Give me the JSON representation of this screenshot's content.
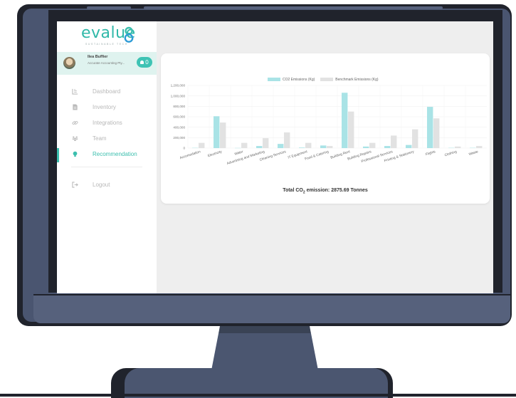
{
  "brand": {
    "logo_text": "evalue",
    "logo_tagline": "SUSTAINABLE TECH",
    "accent_color": "#3cbfae"
  },
  "user": {
    "name": "Ilea Buffier",
    "org": "Accurate Accounting Pty...",
    "notifications": "0"
  },
  "nav": {
    "items": [
      {
        "label": "Dashboard",
        "icon": "dashboard-icon"
      },
      {
        "label": "Inventory",
        "icon": "inventory-icon"
      },
      {
        "label": "Integrations",
        "icon": "link-icon"
      },
      {
        "label": "Team",
        "icon": "team-icon"
      },
      {
        "label": "Recommendation",
        "icon": "lightbulb-icon",
        "active": true
      }
    ],
    "logout_label": "Logout"
  },
  "chart_data": {
    "type": "bar",
    "categories": [
      "Accomodation",
      "Electricity",
      "Water",
      "Advertising and Marketing",
      "Cleaning Services",
      "IT Equipment",
      "Food & Catering",
      "Building Rent",
      "Building Repairs",
      "Professional Services",
      "Printing & Stationery",
      "Flights",
      "Clothing",
      "Waste"
    ],
    "series": [
      {
        "name": "CO2 Emissions (Kg)",
        "color": "#a9e3e6",
        "values": [
          5000,
          610000,
          3000,
          40000,
          80000,
          10000,
          50000,
          1060000,
          30000,
          40000,
          60000,
          790000,
          5000,
          5000
        ]
      },
      {
        "name": "Benchmark Emissions (Kg)",
        "color": "#e2e2e2",
        "values": [
          100000,
          490000,
          100000,
          190000,
          300000,
          100000,
          40000,
          700000,
          100000,
          240000,
          360000,
          570000,
          30000,
          40000
        ]
      }
    ],
    "yticks": [
      "0",
      "200,000",
      "400,000",
      "600,000",
      "800,000",
      "1,000,000",
      "1,200,000"
    ],
    "ylim": [
      0,
      1200000
    ],
    "legend_position": "top-center",
    "grid": true
  },
  "summary": {
    "total_prefix": "Total CO",
    "total_sub": "2",
    "total_suffix": " emission: 2875.69 Tonnes"
  }
}
